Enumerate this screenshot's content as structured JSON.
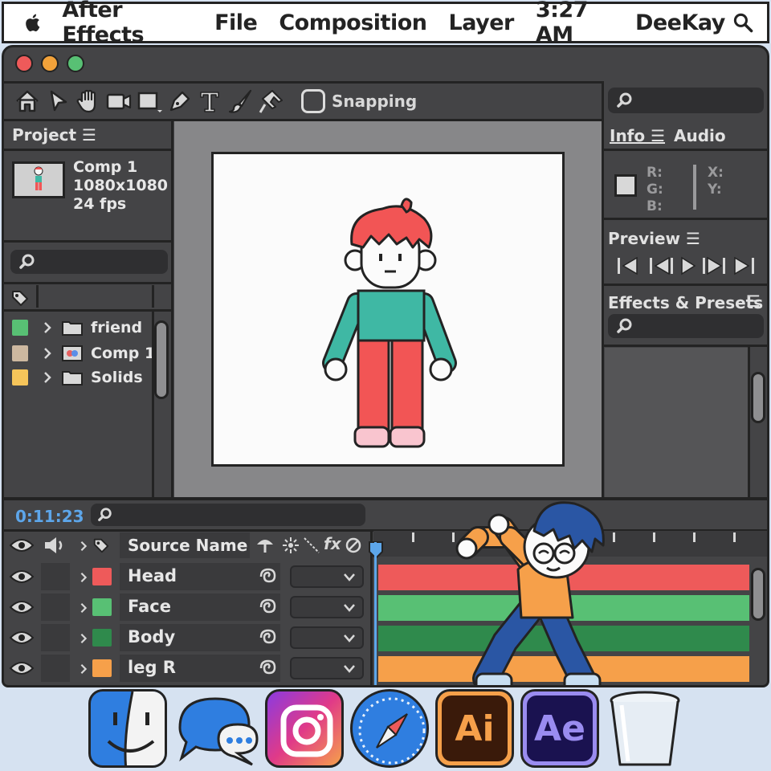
{
  "menubar": {
    "app_name": "After Effects",
    "menus": [
      "File",
      "Composition",
      "Layer"
    ],
    "clock": "3:27 AM",
    "user": "DeeKay"
  },
  "toolbar": {
    "tools": [
      "home-icon",
      "selection-arrow-icon",
      "hand-icon",
      "camera-icon",
      "rectangle-icon",
      "pen-icon",
      "type-icon",
      "brush-icon",
      "puppet-pin-icon"
    ],
    "snapping_label": "Snapping"
  },
  "project": {
    "title": "Project ☰",
    "comp_name": "Comp 1",
    "comp_size": "1080x1080",
    "comp_fps": "24 fps",
    "items": [
      {
        "label": "friend",
        "color": "#58c074",
        "icon": "folder-icon"
      },
      {
        "label": "Comp 1",
        "color": "#cdb8a0",
        "icon": "composition-icon"
      },
      {
        "label": "Solids",
        "color": "#f6c55a",
        "icon": "folder-icon"
      }
    ]
  },
  "info": {
    "tab_info": "Info ☰",
    "tab_audio": "Audio",
    "rgb": [
      "R:",
      "G:",
      "B:"
    ],
    "xy": [
      "X:",
      "Y:"
    ]
  },
  "preview": {
    "title": "Preview ☰",
    "controls": [
      "first-frame-icon",
      "previous-frame-icon",
      "play-icon",
      "next-frame-icon",
      "last-frame-icon"
    ]
  },
  "effects": {
    "title": "Effects & Presets",
    "menu_icon": "☰"
  },
  "timeline": {
    "timecode": "0:11:23",
    "source_name_header": "Source Name",
    "fx_label": "fx",
    "layers": [
      {
        "name": "Head",
        "color": "#ee5a5a"
      },
      {
        "name": "Face",
        "color": "#58c074"
      },
      {
        "name": "Body",
        "color": "#2f8a4c"
      },
      {
        "name": "leg R",
        "color": "#f6a04a"
      }
    ]
  },
  "dock": {
    "apps": [
      "finder-icon",
      "messages-icon",
      "instagram-icon",
      "safari-icon",
      "illustrator-icon",
      "after-effects-icon",
      "trash-icon"
    ],
    "ai_label": "Ai",
    "ae_label": "Ae"
  }
}
